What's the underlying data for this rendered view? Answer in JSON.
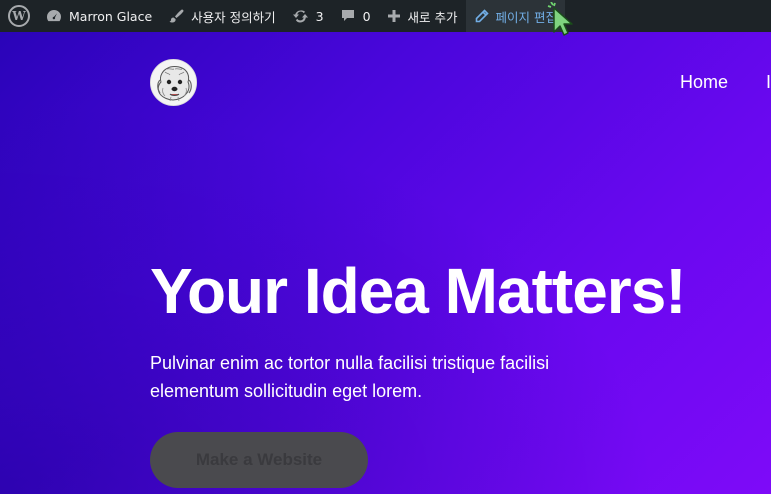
{
  "adminbar": {
    "site_name": "Marron Glace",
    "customize": "사용자 정의하기",
    "updates_count": "3",
    "comments_count": "0",
    "new_label": "새로 추가",
    "edit_page": "페이지 편집"
  },
  "nav": {
    "items": [
      "Home",
      "In"
    ]
  },
  "hero": {
    "headline": "Your Idea Matters!",
    "subtext": "Pulvinar enim ac tortor nulla facilisi tristique facilisi elementum sollicitudin eget lorem.",
    "cta_label": "Make a Website"
  },
  "colors": {
    "adminbar_bg": "#1d2327",
    "active_link": "#72aee6",
    "hero_start": "#2a04b8",
    "hero_end": "#7e0af8"
  }
}
